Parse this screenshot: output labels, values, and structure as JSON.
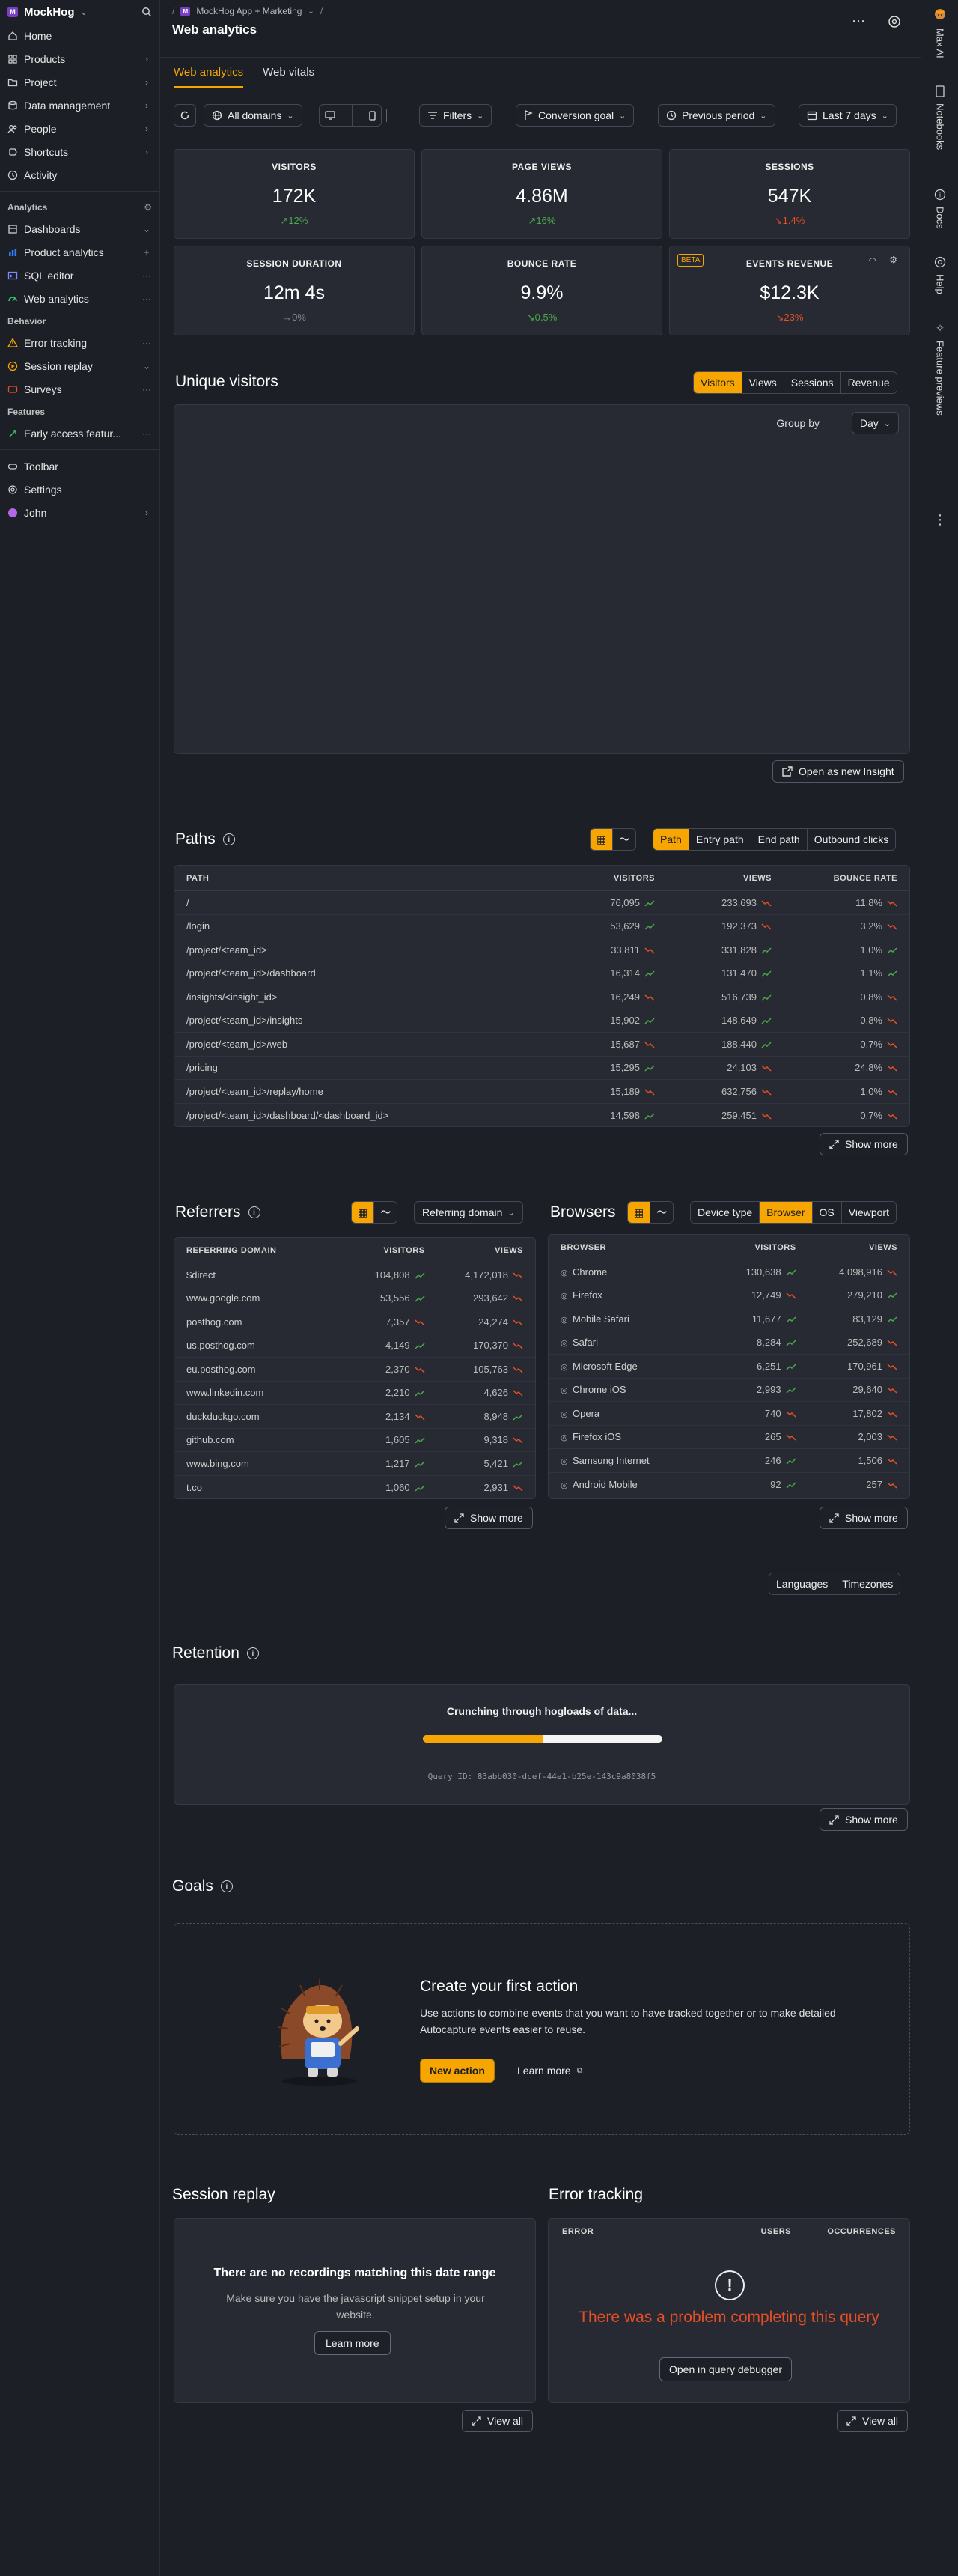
{
  "org": {
    "badge": "M",
    "name": "MockHog"
  },
  "sidebar": {
    "items_top": [
      {
        "label": "Home",
        "icon": "home-icon"
      },
      {
        "label": "Products",
        "icon": "products-icon",
        "tail": "›"
      },
      {
        "label": "Project",
        "icon": "folder-icon",
        "tail": "›"
      },
      {
        "label": "Data management",
        "icon": "database-icon",
        "tail": "›"
      },
      {
        "label": "People",
        "icon": "people-icon",
        "tail": "›"
      },
      {
        "label": "Shortcuts",
        "icon": "shortcuts-icon",
        "tail": "›"
      },
      {
        "label": "Activity",
        "icon": "activity-icon"
      }
    ],
    "analytics_title": "Analytics",
    "analytics": [
      {
        "label": "Dashboards",
        "icon": "dashboard-icon",
        "tail": "⌄"
      },
      {
        "label": "Product analytics",
        "icon": "product-analytics-icon",
        "tail": "+"
      },
      {
        "label": "SQL editor",
        "icon": "sql-icon",
        "tail": "···"
      },
      {
        "label": "Web analytics",
        "icon": "web-analytics-icon",
        "tail": "···"
      }
    ],
    "behavior_title": "Behavior",
    "behavior": [
      {
        "label": "Error tracking",
        "icon": "warning-icon",
        "tail": "···"
      },
      {
        "label": "Session replay",
        "icon": "replay-icon",
        "tail": "⌄"
      },
      {
        "label": "Surveys",
        "icon": "survey-icon",
        "tail": "···"
      }
    ],
    "features_title": "Features",
    "features": [
      {
        "label": "Early access featur...",
        "icon": "rocket-icon",
        "tail": "···"
      }
    ],
    "bottom": [
      {
        "label": "Toolbar",
        "icon": "toolbar-icon"
      },
      {
        "label": "Settings",
        "icon": "gear-icon"
      },
      {
        "label": "John",
        "icon": "avatar",
        "tail": "›"
      }
    ]
  },
  "header": {
    "crumb_badge": "M",
    "crumb_project": "MockHog App + Marketing",
    "crumb_sep": "/",
    "title": "Web analytics",
    "tabs": [
      "Web analytics",
      "Web vitals"
    ]
  },
  "filters": {
    "domain": "All domains",
    "filters_label": "Filters",
    "conversion": "Conversion goal",
    "compare": "Previous period",
    "date_range": "Last 7 days"
  },
  "kpis": [
    {
      "title": "VISITORS",
      "value": "172K",
      "delta": "↗12%",
      "trend": "up"
    },
    {
      "title": "PAGE VIEWS",
      "value": "4.86M",
      "delta": "↗16%",
      "trend": "up"
    },
    {
      "title": "SESSIONS",
      "value": "547K",
      "delta": "↘1.4%",
      "trend": "down"
    },
    {
      "title": "SESSION DURATION",
      "value": "12m 4s",
      "delta": "→0%",
      "trend": "neutral"
    },
    {
      "title": "BOUNCE RATE",
      "value": "9.9%",
      "delta": "↘0.5%",
      "trend": "up"
    },
    {
      "title": "EVENTS REVENUE",
      "value": "$12.3K",
      "delta": "↘23%",
      "trend": "down",
      "badge": "BETA"
    }
  ],
  "unique_visitors": {
    "title": "Unique visitors",
    "tabs": [
      "Visitors",
      "Views",
      "Sessions",
      "Revenue"
    ],
    "group_by_label": "Group by",
    "group_by_value": "Day",
    "open_insight": "Open as new Insight"
  },
  "paths": {
    "title": "Paths",
    "tabs": [
      "Path",
      "Entry path",
      "End path",
      "Outbound clicks"
    ],
    "columns": [
      "PATH",
      "VISITORS",
      "VIEWS",
      "BOUNCE RATE"
    ],
    "rows": [
      {
        "path": "/",
        "visitors": "76,095",
        "v_trend": "up",
        "views": "233,693",
        "w_trend": "down",
        "bounce": "11.8%",
        "b_trend": "down"
      },
      {
        "path": "/login",
        "visitors": "53,629",
        "v_trend": "up",
        "views": "192,373",
        "w_trend": "down",
        "bounce": "3.2%",
        "b_trend": "down"
      },
      {
        "path": "/project/<team_id>",
        "visitors": "33,811",
        "v_trend": "down",
        "views": "331,828",
        "w_trend": "up",
        "bounce": "1.0%",
        "b_trend": "up"
      },
      {
        "path": "/project/<team_id>/dashboard",
        "visitors": "16,314",
        "v_trend": "up",
        "views": "131,470",
        "w_trend": "up",
        "bounce": "1.1%",
        "b_trend": "up"
      },
      {
        "path": "/insights/<insight_id>",
        "visitors": "16,249",
        "v_trend": "down",
        "views": "516,739",
        "w_trend": "up",
        "bounce": "0.8%",
        "b_trend": "down"
      },
      {
        "path": "/project/<team_id>/insights",
        "visitors": "15,902",
        "v_trend": "up",
        "views": "148,649",
        "w_trend": "up",
        "bounce": "0.8%",
        "b_trend": "down"
      },
      {
        "path": "/project/<team_id>/web",
        "visitors": "15,687",
        "v_trend": "down",
        "views": "188,440",
        "w_trend": "up",
        "bounce": "0.7%",
        "b_trend": "down"
      },
      {
        "path": "/pricing",
        "visitors": "15,295",
        "v_trend": "up",
        "views": "24,103",
        "w_trend": "down",
        "bounce": "24.8%",
        "b_trend": "down"
      },
      {
        "path": "/project/<team_id>/replay/home",
        "visitors": "15,189",
        "v_trend": "down",
        "views": "632,756",
        "w_trend": "down",
        "bounce": "1.0%",
        "b_trend": "down"
      },
      {
        "path": "/project/<team_id>/dashboard/<dashboard_id>",
        "visitors": "14,598",
        "v_trend": "up",
        "views": "259,451",
        "w_trend": "down",
        "bounce": "0.7%",
        "b_trend": "down"
      }
    ],
    "show_more": "Show more"
  },
  "referrers": {
    "title": "Referrers",
    "dropdown": "Referring domain",
    "columns": [
      "REFERRING DOMAIN",
      "VISITORS",
      "VIEWS"
    ],
    "rows": [
      {
        "name": "$direct",
        "visitors": "104,808",
        "v_trend": "up",
        "views": "4,172,018",
        "w_trend": "down"
      },
      {
        "name": "www.google.com",
        "visitors": "53,556",
        "v_trend": "up",
        "views": "293,642",
        "w_trend": "down"
      },
      {
        "name": "posthog.com",
        "visitors": "7,357",
        "v_trend": "down",
        "views": "24,274",
        "w_trend": "down"
      },
      {
        "name": "us.posthog.com",
        "visitors": "4,149",
        "v_trend": "up",
        "views": "170,370",
        "w_trend": "down"
      },
      {
        "name": "eu.posthog.com",
        "visitors": "2,370",
        "v_trend": "down",
        "views": "105,763",
        "w_trend": "down"
      },
      {
        "name": "www.linkedin.com",
        "visitors": "2,210",
        "v_trend": "up",
        "views": "4,626",
        "w_trend": "down"
      },
      {
        "name": "duckduckgo.com",
        "visitors": "2,134",
        "v_trend": "down",
        "views": "8,948",
        "w_trend": "up"
      },
      {
        "name": "github.com",
        "visitors": "1,605",
        "v_trend": "up",
        "views": "9,318",
        "w_trend": "down"
      },
      {
        "name": "www.bing.com",
        "visitors": "1,217",
        "v_trend": "up",
        "views": "5,421",
        "w_trend": "up"
      },
      {
        "name": "t.co",
        "visitors": "1,060",
        "v_trend": "up",
        "views": "2,931",
        "w_trend": "down"
      }
    ],
    "show_more": "Show more"
  },
  "browsers": {
    "title": "Browsers",
    "tabs": [
      "Device type",
      "Browser",
      "OS",
      "Viewport"
    ],
    "columns": [
      "BROWSER",
      "VISITORS",
      "VIEWS"
    ],
    "rows": [
      {
        "name": "Chrome",
        "visitors": "130,638",
        "v_trend": "up",
        "views": "4,098,916",
        "w_trend": "down"
      },
      {
        "name": "Firefox",
        "visitors": "12,749",
        "v_trend": "down",
        "views": "279,210",
        "w_trend": "up"
      },
      {
        "name": "Mobile Safari",
        "visitors": "11,677",
        "v_trend": "up",
        "views": "83,129",
        "w_trend": "up"
      },
      {
        "name": "Safari",
        "visitors": "8,284",
        "v_trend": "up",
        "views": "252,689",
        "w_trend": "down"
      },
      {
        "name": "Microsoft Edge",
        "visitors": "6,251",
        "v_trend": "up",
        "views": "170,961",
        "w_trend": "down"
      },
      {
        "name": "Chrome iOS",
        "visitors": "2,993",
        "v_trend": "up",
        "views": "29,640",
        "w_trend": "down"
      },
      {
        "name": "Opera",
        "visitors": "740",
        "v_trend": "down",
        "views": "17,802",
        "w_trend": "down"
      },
      {
        "name": "Firefox iOS",
        "visitors": "265",
        "v_trend": "down",
        "views": "2,003",
        "w_trend": "down"
      },
      {
        "name": "Samsung Internet",
        "visitors": "246",
        "v_trend": "up",
        "views": "1,506",
        "w_trend": "down"
      },
      {
        "name": "Android Mobile",
        "visitors": "92",
        "v_trend": "up",
        "views": "257",
        "w_trend": "down"
      }
    ],
    "show_more": "Show more"
  },
  "extra_tabs": [
    "Languages",
    "Timezones"
  ],
  "retention": {
    "title": "Retention",
    "loading": "Crunching through hogloads of data...",
    "progress": 0.5,
    "query_id": "Query ID: 83abb030-dcef-44e1-b25e-143c9a8038f5",
    "show_more": "Show more"
  },
  "goals": {
    "title": "Goals",
    "empty_title": "Create your first action",
    "empty_text": "Use actions to combine events that you want to have tracked together or to make detailed Autocapture events easier to reuse.",
    "new_action": "New action",
    "learn_more": "Learn more"
  },
  "session_replay": {
    "title": "Session replay",
    "empty_title": "There are no recordings matching this date range",
    "empty_text": "Make sure you have the javascript snippet setup in your website.",
    "learn_more": "Learn more",
    "view_all": "View all"
  },
  "error_tracking": {
    "title": "Error tracking",
    "columns": [
      "ERROR",
      "USERS",
      "OCCURRENCES"
    ],
    "error_msg": "There was a problem completing this query",
    "debug_btn": "Open in query debugger",
    "view_all": "View all"
  },
  "rightbar": {
    "items": [
      "Max AI",
      "Notebooks",
      "Docs",
      "Help",
      "Feature previews"
    ]
  },
  "colors": {
    "accent": "#f7a501",
    "up": "#49a84a",
    "down": "#e44f26",
    "bg": "#1d1f27",
    "card": "#272a33"
  }
}
